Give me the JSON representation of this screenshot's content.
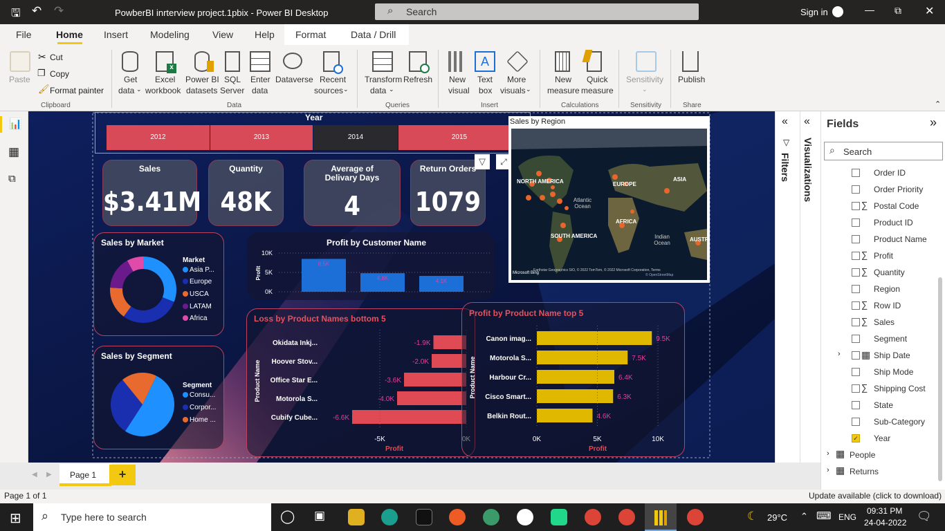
{
  "window": {
    "title": "PowberBI inrterview project.1pbix - Power BI Desktop",
    "search_placeholder": "Search",
    "sign_in": "Sign in"
  },
  "ribbon_tabs": [
    "File",
    "Home",
    "Insert",
    "Modeling",
    "View",
    "Help",
    "Format",
    "Data / Drill"
  ],
  "ribbon": {
    "paste": "Paste",
    "cut": "Cut",
    "copy": "Copy",
    "format_painter": "Format painter",
    "clipboard": "Clipboard",
    "get_data": [
      "Get",
      "data"
    ],
    "excel": [
      "Excel",
      "workbook"
    ],
    "pbi_datasets": [
      "Power BI",
      "datasets"
    ],
    "sql": [
      "SQL",
      "Server"
    ],
    "enter_data": [
      "Enter",
      "data"
    ],
    "dataverse": "Dataverse",
    "recent": [
      "Recent",
      "sources"
    ],
    "data_group": "Data",
    "transform": [
      "Transform",
      "data"
    ],
    "refresh": "Refresh",
    "queries": "Queries",
    "new_visual": [
      "New",
      "visual"
    ],
    "text_box": [
      "Text",
      "box"
    ],
    "more_visuals": [
      "More",
      "visuals"
    ],
    "insert_group": "Insert",
    "new_measure": [
      "New",
      "measure"
    ],
    "quick_measure": [
      "Quick",
      "measure"
    ],
    "calculations": "Calculations",
    "sensitivity": "Sensitivity",
    "sensitivity_group": "Sensitivity",
    "publish": "Publish",
    "share": "Share"
  },
  "slicer": {
    "title": "Year",
    "years": [
      "2012",
      "2013",
      "2014",
      "2015"
    ],
    "selected": "2014"
  },
  "kpis": [
    {
      "title": "Sales",
      "value": "$3.41M"
    },
    {
      "title": "Quantity",
      "value": "48K"
    },
    {
      "title": "Average of Delivary Days",
      "value": "4"
    },
    {
      "title": "Return Orders",
      "value": "1079"
    }
  ],
  "map": {
    "title": "Sales by Region",
    "labels": [
      "NORTH AMERICA",
      "EUROPE",
      "ASIA",
      "Atlantic Ocean",
      "AFRICA",
      "SOUTH AMERICA",
      "Indian Ocean",
      "AUSTR"
    ],
    "attribution": "Earthstar Geographics SIO, © 2022 TomTom, © 2022 Microsoft Corporation, Terms",
    "osm": "© OpenStreetMap",
    "bing": "Microsoft Bing"
  },
  "colors": {
    "asia": "#1e90ff",
    "europe": "#1a2fb0",
    "usca": "#e86a2e",
    "latam": "#6a1a8a",
    "africa": "#e04aa8",
    "bar_blue": "#1c6fd6",
    "loss_red": "#e04a55",
    "gold": "#e0b800"
  },
  "chart_data": [
    {
      "type": "pie",
      "title": "Sales by Market",
      "legend_title": "Market",
      "categories": [
        "Asia P...",
        "Europe",
        "USCA",
        "LATAM",
        "Africa"
      ],
      "values": [
        31,
        29,
        16,
        16,
        8
      ]
    },
    {
      "type": "pie",
      "title": "Sales by Segment",
      "legend_title": "Segment",
      "categories": [
        "Consu...",
        "Corpor...",
        "Home ..."
      ],
      "values": [
        52,
        30,
        18
      ]
    },
    {
      "type": "bar",
      "title": "Profit by Customer Name",
      "ylabel": "Profit",
      "ticks": [
        "10K",
        "5K",
        "0K"
      ],
      "ylim": [
        0,
        10000
      ],
      "values": [
        8500,
        4800,
        4100
      ],
      "labels": [
        "8.5K",
        "4.8K",
        "4.1K"
      ]
    },
    {
      "type": "bar",
      "orientation": "horizontal",
      "title": "Loss by Product Names bottom 5",
      "xlabel": "Profit",
      "ylabel": "Product Name",
      "categories": [
        "Okidata Inkj...",
        "Hoover Stov...",
        "Office Star E...",
        "Motorola S...",
        "Cubify Cube..."
      ],
      "values": [
        -1900,
        -2000,
        -3600,
        -4000,
        -6600
      ],
      "labels": [
        "-1.9K",
        "-2.0K",
        "-3.6K",
        "-4.0K",
        "-6.6K"
      ],
      "ticks": [
        "-5K",
        "0K"
      ],
      "xlim": [
        -7000,
        0
      ]
    },
    {
      "type": "bar",
      "orientation": "horizontal",
      "title": "Profit by Product Name top 5",
      "xlabel": "Profit",
      "ylabel": "Product Name",
      "categories": [
        "Canon imag...",
        "Motorola S...",
        "Harbour Cr...",
        "Cisco Smart...",
        "Belkin Rout..."
      ],
      "values": [
        9500,
        7500,
        6400,
        6300,
        4600
      ],
      "labels": [
        "9.5K",
        "7.5K",
        "6.4K",
        "6.3K",
        "4.6K"
      ],
      "ticks": [
        "0K",
        "5K",
        "10K"
      ],
      "xlim": [
        0,
        10000
      ]
    }
  ],
  "panes": {
    "filters": "Filters",
    "visualizations": "Visualizations",
    "fields": "Fields",
    "fields_search": "Search"
  },
  "fields": [
    {
      "name": "Order ID",
      "sigma": false,
      "checked": false
    },
    {
      "name": "Order Priority",
      "sigma": false,
      "checked": false
    },
    {
      "name": "Postal Code",
      "sigma": true,
      "checked": false
    },
    {
      "name": "Product ID",
      "sigma": false,
      "checked": false
    },
    {
      "name": "Product Name",
      "sigma": false,
      "checked": false
    },
    {
      "name": "Profit",
      "sigma": true,
      "checked": false
    },
    {
      "name": "Quantity",
      "sigma": true,
      "checked": false
    },
    {
      "name": "Region",
      "sigma": false,
      "checked": false
    },
    {
      "name": "Row ID",
      "sigma": true,
      "checked": false
    },
    {
      "name": "Sales",
      "sigma": true,
      "checked": false
    },
    {
      "name": "Segment",
      "sigma": false,
      "checked": false
    },
    {
      "name": "Ship Date",
      "sigma": false,
      "checked": false,
      "date": true
    },
    {
      "name": "Ship Mode",
      "sigma": false,
      "checked": false
    },
    {
      "name": "Shipping Cost",
      "sigma": true,
      "checked": false
    },
    {
      "name": "State",
      "sigma": false,
      "checked": false
    },
    {
      "name": "Sub-Category",
      "sigma": false,
      "checked": false
    },
    {
      "name": "Year",
      "sigma": false,
      "checked": true
    }
  ],
  "tables": [
    "People",
    "Returns"
  ],
  "pages": {
    "current": "Page 1",
    "add": "+"
  },
  "status": {
    "left": "Page 1 of 1",
    "right": "Update available (click to download)"
  },
  "taskbar": {
    "search": "Type here to search",
    "weather": "29°C",
    "lang": "ENG",
    "time": "09:31 PM",
    "date": "24-04-2022"
  }
}
